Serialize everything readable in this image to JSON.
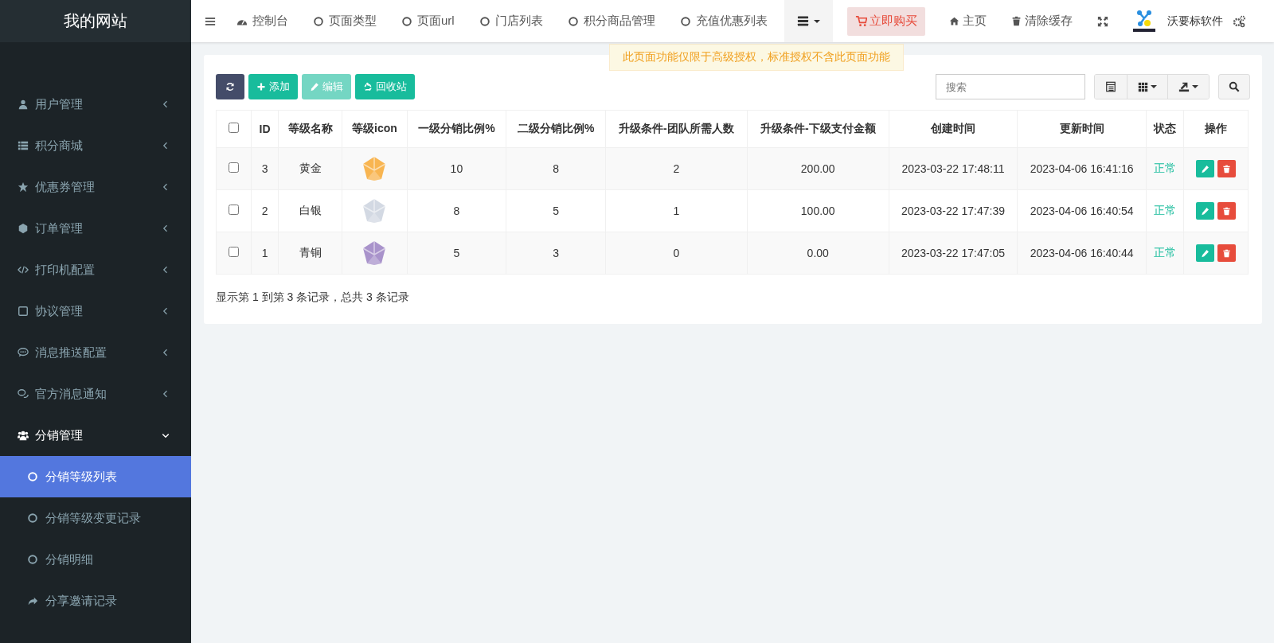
{
  "site": {
    "title": "我的网站"
  },
  "sidebar": {
    "items": [
      {
        "label": "用户管理",
        "kind": "user",
        "expanded": false
      },
      {
        "label": "积分商城",
        "kind": "list",
        "expanded": false
      },
      {
        "label": "优惠券管理",
        "kind": "star",
        "expanded": false
      },
      {
        "label": "订单管理",
        "kind": "cube",
        "expanded": false
      },
      {
        "label": "打印机配置",
        "kind": "code",
        "expanded": false
      },
      {
        "label": "协议管理",
        "kind": "note",
        "expanded": false
      },
      {
        "label": "消息推送配置",
        "kind": "chat",
        "expanded": false
      },
      {
        "label": "官方消息通知",
        "kind": "comments",
        "expanded": false
      },
      {
        "label": "分销管理",
        "kind": "users",
        "expanded": true,
        "children": [
          {
            "label": "分销等级列表",
            "kind": "circle",
            "selected": true
          },
          {
            "label": "分销等级变更记录",
            "kind": "circle",
            "selected": false
          },
          {
            "label": "分销明细",
            "kind": "circle",
            "selected": false
          },
          {
            "label": "分享邀请记录",
            "kind": "share",
            "selected": false
          }
        ]
      }
    ]
  },
  "topbar": {
    "tabs": [
      {
        "label": "控制台",
        "kind": "dashboard"
      },
      {
        "label": "页面类型",
        "kind": "circle"
      },
      {
        "label": "页面url",
        "kind": "circle"
      },
      {
        "label": "门店列表",
        "kind": "circle"
      },
      {
        "label": "积分商品管理",
        "kind": "circle"
      },
      {
        "label": "充值优惠列表",
        "kind": "circle"
      }
    ],
    "buy_button": {
      "label": "立即购买"
    },
    "links": [
      {
        "label": "主页",
        "kind": "home"
      },
      {
        "label": "清除缓存",
        "kind": "trash"
      }
    ],
    "user": {
      "name": "沃要标软件"
    }
  },
  "notice": {
    "text": "此页面功能仅限于高级授权，标准授权不含此页面功能"
  },
  "toolbar": {
    "buttons": [
      {
        "label": "添加",
        "kind": "plus",
        "disabled": false
      },
      {
        "label": "编辑",
        "kind": "pencil",
        "disabled": true
      },
      {
        "label": "回收站",
        "kind": "recycle",
        "disabled": false
      }
    ],
    "search": {
      "placeholder": "搜索"
    }
  },
  "table": {
    "select_all_checked": false,
    "columns": [
      "ID",
      "等级名称",
      "等级icon",
      "一级分销比例%",
      "二级分销比例%",
      "升级条件-团队所需人数",
      "升级条件-下级支付金额",
      "创建时间",
      "更新时间",
      "状态",
      "操作"
    ],
    "rows": [
      {
        "checked": false,
        "id": "3",
        "name": "黄金",
        "color": "#f8b551",
        "level1": "10",
        "level2": "8",
        "team": "2",
        "amount": "200.00",
        "created": "2023-03-22 17:48:11",
        "updated": "2023-04-06 16:41:16",
        "status": "正常"
      },
      {
        "checked": false,
        "id": "2",
        "name": "白银",
        "color": "#d3d9e3",
        "level1": "8",
        "level2": "5",
        "team": "1",
        "amount": "100.00",
        "created": "2023-03-22 17:47:39",
        "updated": "2023-04-06 16:40:54",
        "status": "正常"
      },
      {
        "checked": false,
        "id": "1",
        "name": "青铜",
        "color": "#a993cb",
        "level1": "5",
        "level2": "3",
        "team": "0",
        "amount": "0.00",
        "created": "2023-03-22 17:47:05",
        "updated": "2023-04-06 16:40:44",
        "status": "正常"
      }
    ],
    "footer": "显示第 1 到第 3 条记录，总共 3 条记录"
  }
}
